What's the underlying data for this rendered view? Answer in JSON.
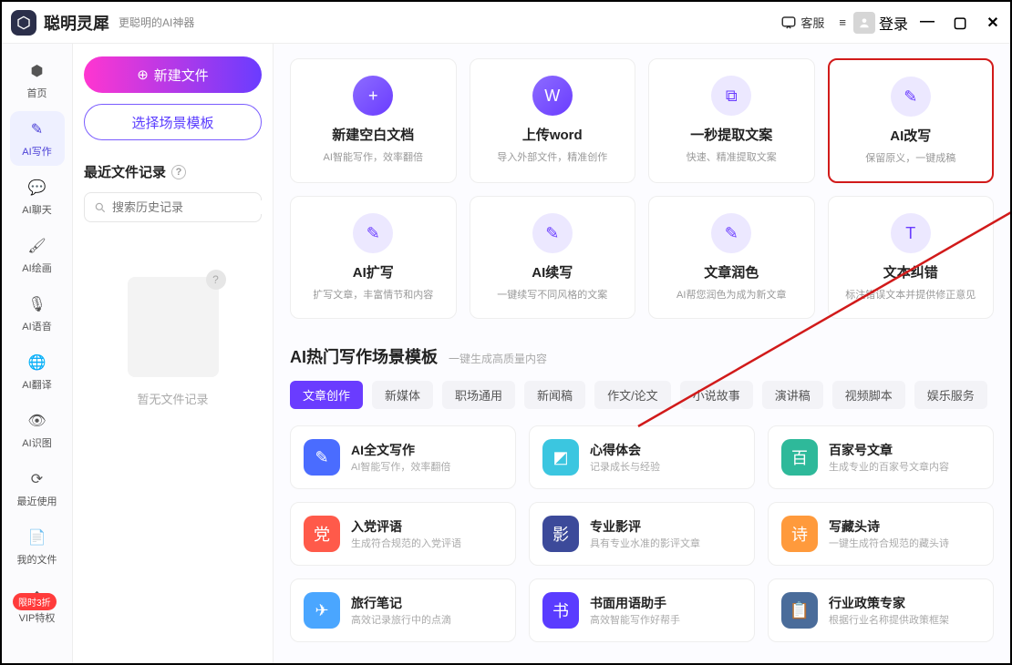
{
  "brand": "聪明灵犀",
  "slogan": "更聪明的AI神器",
  "header": {
    "support": "客服",
    "login": "登录"
  },
  "sidebar": [
    {
      "label": "首页"
    },
    {
      "label": "AI写作",
      "active": true
    },
    {
      "label": "AI聊天"
    },
    {
      "label": "AI绘画"
    },
    {
      "label": "AI语音"
    },
    {
      "label": "AI翻译"
    },
    {
      "label": "AI识图"
    },
    {
      "label": "最近使用"
    },
    {
      "label": "我的文件"
    },
    {
      "label": "VIP特权"
    }
  ],
  "sidebar_badge": "限时3折",
  "left_panel": {
    "new_file": "新建文件",
    "choose_tpl": "选择场景模板",
    "recent_title": "最近文件记录",
    "search_placeholder": "搜索历史记录",
    "empty": "暂无文件记录"
  },
  "cards": [
    {
      "title": "新建空白文档",
      "sub": "AI智能写作，效率翻倍",
      "ico": "+",
      "cls": "ico-purple"
    },
    {
      "title": "上传word",
      "sub": "导入外部文件，精准创作",
      "ico": "W",
      "cls": "ico-purple"
    },
    {
      "title": "一秒提取文案",
      "sub": "快速、精准提取文案",
      "ico": "⧉",
      "cls": "ico-lav"
    },
    {
      "title": "AI改写",
      "sub": "保留原义，一键成稿",
      "ico": "✎",
      "cls": "ico-lav",
      "highlight": true
    },
    {
      "title": "AI扩写",
      "sub": "扩写文章，丰富情节和内容",
      "ico": "✎",
      "cls": "ico-lav"
    },
    {
      "title": "AI续写",
      "sub": "一键续写不同风格的文案",
      "ico": "✎",
      "cls": "ico-lav"
    },
    {
      "title": "文章润色",
      "sub": "AI帮您润色为成为新文章",
      "ico": "✎",
      "cls": "ico-lav"
    },
    {
      "title": "文本纠错",
      "sub": "标注错误文本并提供修正意见",
      "ico": "T",
      "cls": "ico-lav"
    }
  ],
  "section": {
    "title": "AI热门写作场景模板",
    "sub": "一键生成高质量内容"
  },
  "tabs": [
    "文章创作",
    "新媒体",
    "职场通用",
    "新闻稿",
    "作文/论文",
    "小说故事",
    "演讲稿",
    "视频脚本",
    "娱乐服务"
  ],
  "active_tab": 0,
  "templates": [
    {
      "title": "AI全文写作",
      "sub": "AI智能写作，效率翻倍",
      "cls": "c-blue",
      "ico": "✎"
    },
    {
      "title": "心得体会",
      "sub": "记录成长与经验",
      "cls": "c-cyan",
      "ico": "◩"
    },
    {
      "title": "百家号文章",
      "sub": "生成专业的百家号文章内容",
      "cls": "c-teal",
      "ico": "百"
    },
    {
      "title": "入党评语",
      "sub": "生成符合规范的入党评语",
      "cls": "c-red",
      "ico": "党"
    },
    {
      "title": "专业影评",
      "sub": "具有专业水准的影评文章",
      "cls": "c-navy",
      "ico": "影"
    },
    {
      "title": "写藏头诗",
      "sub": "一键生成符合规范的藏头诗",
      "cls": "c-orange",
      "ico": "诗"
    },
    {
      "title": "旅行笔记",
      "sub": "高效记录旅行中的点滴",
      "cls": "c-sky",
      "ico": "✈"
    },
    {
      "title": "书面用语助手",
      "sub": "高效智能写作好帮手",
      "cls": "c-indigo",
      "ico": "书"
    },
    {
      "title": "行业政策专家",
      "sub": "根据行业名称提供政策框架",
      "cls": "c-slate",
      "ico": "📋"
    }
  ]
}
